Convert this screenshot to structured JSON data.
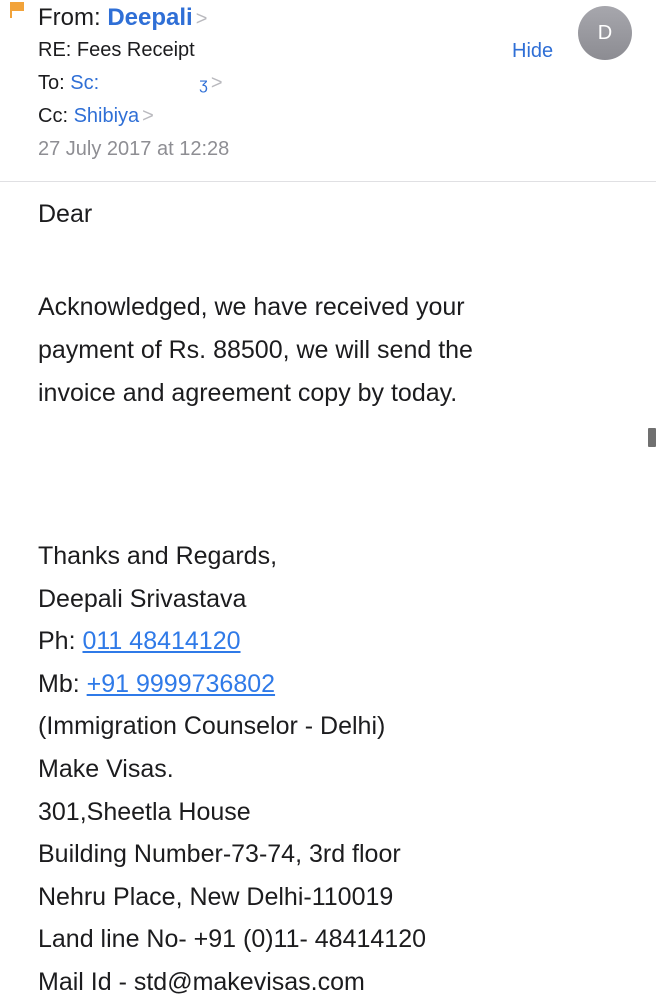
{
  "header": {
    "from_label": "From:",
    "from_name": "Deepali",
    "subject": "RE: Fees Receipt",
    "to_label": "To:",
    "to_name": "Sc:",
    "cc_label": "Cc:",
    "cc_name": "Shibiya",
    "date": "27 July 2017 at 12:28",
    "hide_label": "Hide",
    "avatar_initial": "D",
    "chevron": ">"
  },
  "body": {
    "greeting": "Dear",
    "paragraph": [
      "Acknowledged, we have received your",
      "payment of Rs. 88500, we will send the",
      "invoice and agreement copy by today."
    ]
  },
  "signature": {
    "closing": "Thanks and Regards,",
    "name": "Deepali Srivastava",
    "ph_label": "Ph:",
    "ph_number": "011 48414120",
    "mb_label": "Mb:",
    "mb_number": "+91 9999736802",
    "role": "(Immigration Counselor - Delhi)",
    "company": "Make Visas.",
    "address_1": "301,Sheetla House",
    "address_2": "Building Number-73-74, 3rd floor",
    "address_3": "Nehru Place, New Delhi-110019",
    "landline": "Land line No- +91 (0)11- 48414120",
    "mail": "Mail Id - std@makevisas.com"
  },
  "colors": {
    "accent": "#2f6fd6",
    "link": "#2f7ae8",
    "flag": "#f2a33a",
    "muted": "#8e8e93",
    "avatar": "#9a9aa0"
  }
}
